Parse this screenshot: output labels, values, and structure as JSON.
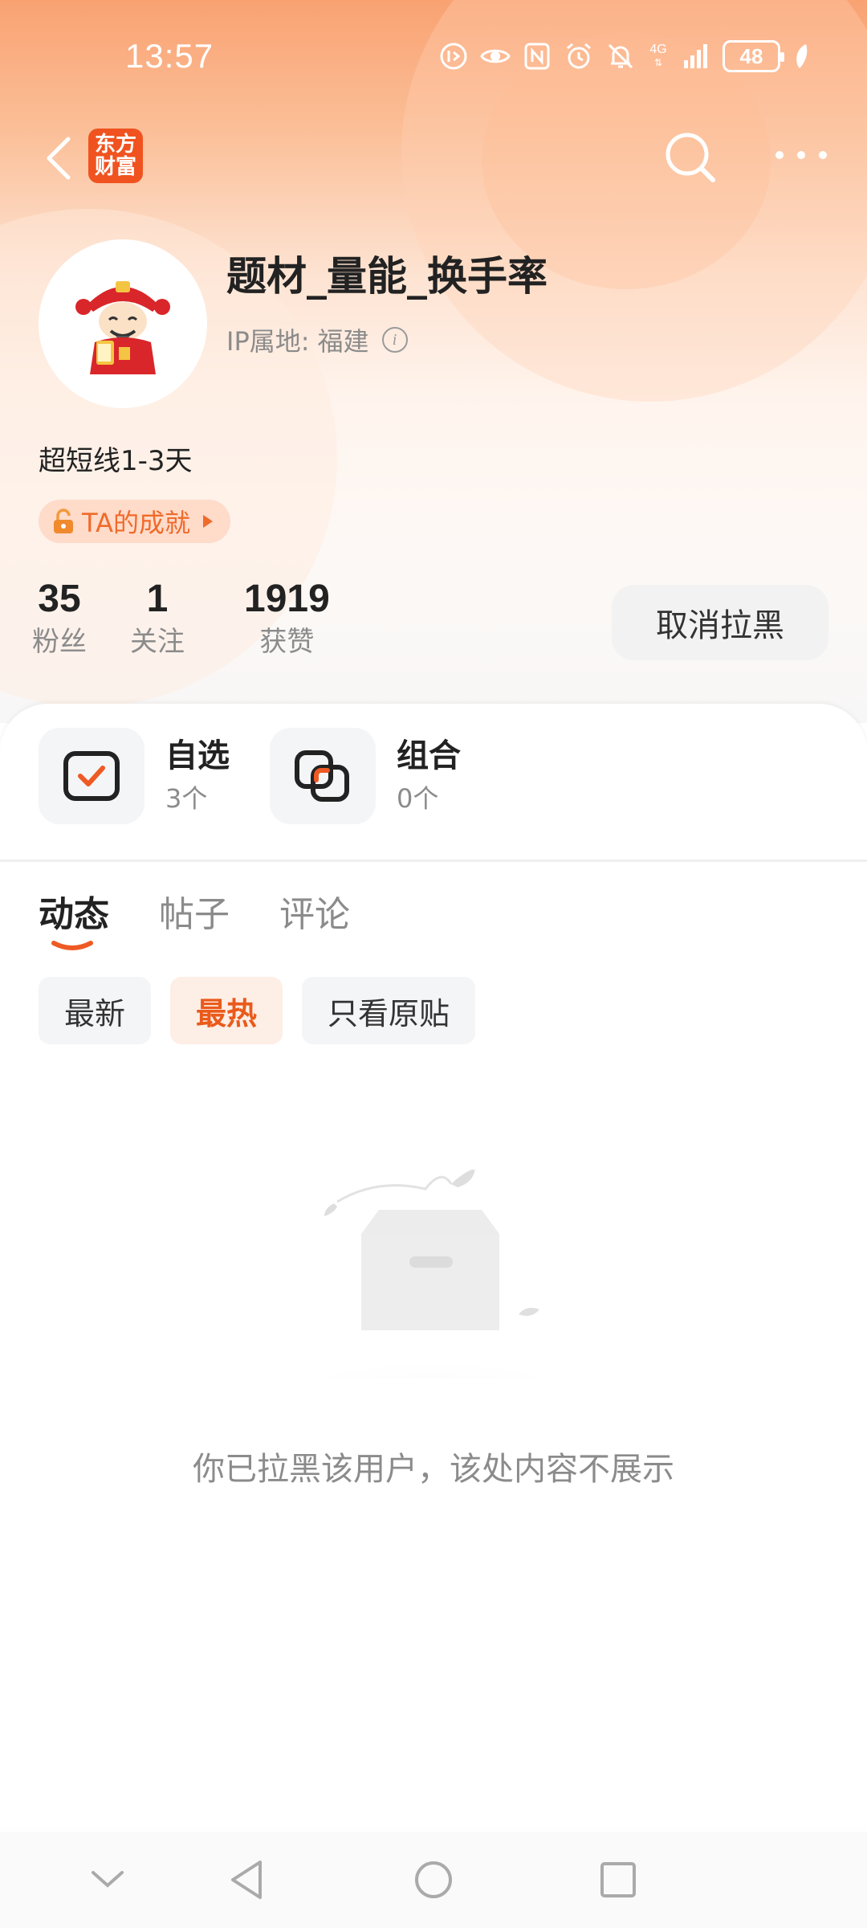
{
  "status_bar": {
    "time": "13:57",
    "network": "4G",
    "battery": "48"
  },
  "nav": {
    "brand_line1": "东方",
    "brand_line2": "财富"
  },
  "profile": {
    "username": "题材_量能_换手率",
    "ip_label": "IP属地:",
    "ip_value": "福建",
    "bio": "超短线1-3天",
    "achievement_label": "TA的成就"
  },
  "stats": [
    {
      "value": "35",
      "label": "粉丝"
    },
    {
      "value": "1",
      "label": "关注"
    },
    {
      "value": "1919",
      "label": "获赞"
    }
  ],
  "unblock_button": "取消拉黑",
  "portfolio": [
    {
      "title": "自选",
      "count": "3个",
      "icon": "watchlist-icon"
    },
    {
      "title": "组合",
      "count": "0个",
      "icon": "portfolio-combo-icon"
    }
  ],
  "tabs": [
    {
      "label": "动态",
      "active": true
    },
    {
      "label": "帖子",
      "active": false
    },
    {
      "label": "评论",
      "active": false
    }
  ],
  "filters": [
    {
      "label": "最新",
      "active": false
    },
    {
      "label": "最热",
      "active": true
    },
    {
      "label": "只看原贴",
      "active": false
    }
  ],
  "empty_message": "你已拉黑该用户，该处内容不展示",
  "colors": {
    "accent": "#ea5a1b",
    "brand": "#f0531f",
    "header_gradient_top": "#f9a272"
  }
}
